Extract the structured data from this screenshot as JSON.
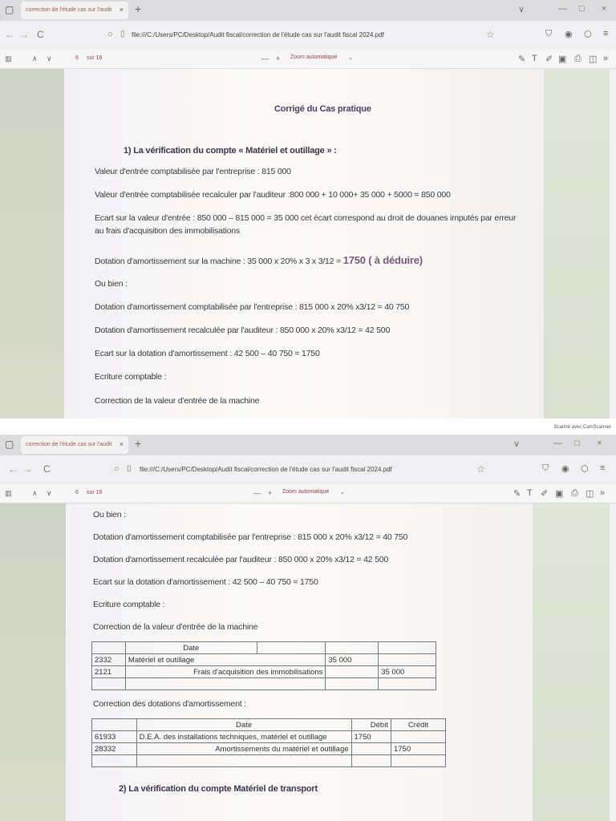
{
  "browser": {
    "tab_title": "correction de l'étude cas sur l'audit",
    "url": "file:///C:/Users/PC/Desktop/Audit fiscal/correction de l'étude cas sur l'audit fiscal 2024.pdf",
    "page_current": "6",
    "page_of": "sur 16",
    "zoom_label": "Zoom automatique",
    "zoom_minus": "—",
    "zoom_plus": "+",
    "icons": {
      "back": "←",
      "forward": "→",
      "reload": "C",
      "close": "×",
      "plus": "+",
      "minimize": "—",
      "restore": "□",
      "star": "☆",
      "menu": "≡",
      "more": "»",
      "up": "∧",
      "down": "∨"
    }
  },
  "scanner_label": "Scanné avec CamScanner",
  "doc_top": {
    "title": "Corrigé du Cas pratique",
    "section1": "1) La vérification du compte « Matériel et outillage » :",
    "lines": [
      "Valeur d'entrée comptabilisée par l'entreprise : 815 000",
      "Valeur d'entrée comptabilisée recalculer par l'auditeur :800 000 + 10 000+ 35 000 + 5000 = 850 000",
      "Ecart sur la valeur d'entrée : 850 000 – 815 000 = 35 000 cet écart correspond au droit de douanes imputés par erreur",
      "au frais d'acquisition des immobilisations"
    ],
    "dotation_prefix": "Dotation d'amortissement sur la machine : 35 000 x 20% x 3 x 3/12 = ",
    "dotation_result": "1750 ( à déduire)",
    "lines2": [
      "Ou bien :",
      "Dotation d'amortissement comptabilisée par l'entreprise : 815 000 x 20% x3/12 = 40 750",
      "Dotation d'amortissement recalculée par l'auditeur : 850 000 x 20% x3/12 = 42 500",
      "Ecart sur la dotation d'amortissement : 42 500 – 40 750 = 1750",
      "Ecriture comptable :",
      "Correction de la valeur d'entrée de la machine"
    ]
  },
  "doc_bottom": {
    "lines": [
      "Ou bien :",
      "Dotation d'amortissement comptabilisée par l'entreprise : 815 000 x 20% x3/12 = 40 750",
      "Dotation d'amortissement recalculée par l'auditeur : 850 000 x 20% x3/12 = 42 500",
      "Ecart sur la dotation d'amortissement : 42 500 – 40 750 = 1750",
      "Ecriture comptable :",
      "Correction de la valeur d'entrée de la machine"
    ],
    "table1": {
      "header_date": "Date",
      "row1": {
        "account": "2332",
        "label": "Matériel et outillage",
        "debit": "35 000",
        "credit": ""
      },
      "row2": {
        "account": "2121",
        "label": "Frais d'acquisition des immobilisations",
        "debit": "",
        "credit": "35 000"
      }
    },
    "subtitle2": "Correction des dotations d'amortissement :",
    "table2": {
      "header_date": "Date",
      "header_debit": "Débit",
      "header_credit": "Crédit",
      "row1": {
        "account": "61933",
        "label": "D.E.A. des installations techniques, matériel et outillage",
        "debit": "1750",
        "credit": ""
      },
      "row2": {
        "account": "28332",
        "label": "Amortissements du matériel et outillage",
        "debit": "",
        "credit": "1750"
      }
    },
    "section2": "2) La vérification du compte Matériel de transport"
  }
}
